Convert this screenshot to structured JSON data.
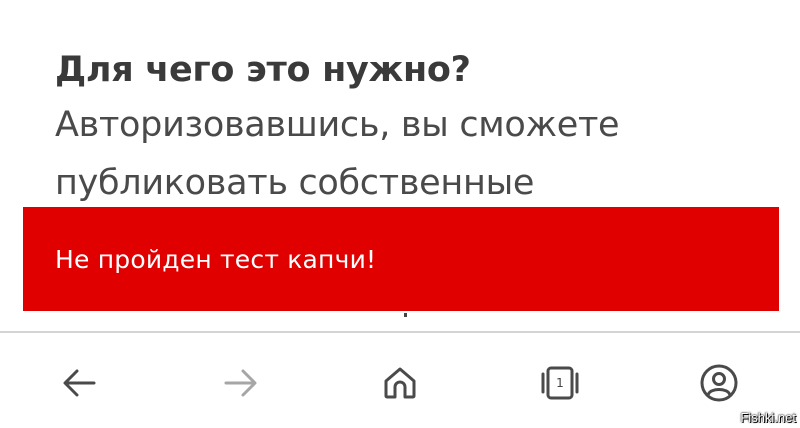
{
  "info_section": {
    "heading": "Для чего это нужно?",
    "body_lines": [
      "Авторизовавшись, вы сможете",
      "публиковать собственные"
    ]
  },
  "error_toast": {
    "message": "Не пройден тест капчи!",
    "background_color": "#e00000",
    "text_color": "#ffffff"
  },
  "bottom_nav": {
    "items": [
      {
        "icon": "arrow-left-icon"
      },
      {
        "icon": "arrow-right-icon"
      },
      {
        "icon": "home-icon"
      },
      {
        "icon": "tabs-icon",
        "count": "1"
      },
      {
        "icon": "profile-icon"
      }
    ]
  },
  "watermark": "Fishki.net"
}
